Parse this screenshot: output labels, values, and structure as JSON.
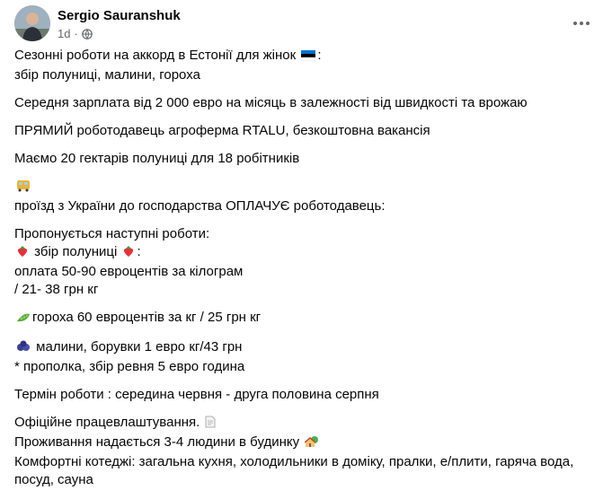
{
  "post": {
    "author": "Sergio Sauranshuk",
    "timestamp": "1d",
    "separator": "·",
    "privacy_icon": "globe-icon",
    "more_icon": "more-options-icon",
    "lines": {
      "l1": "Сезонні роботи на аккорд  в Естонії для жінок",
      "l2": "збір полуниці, малини,  гороха",
      "l3": "Середня зарплата від 2 000 евро на місяць в залежності від швидкості та врожаю",
      "l4": "ПРЯМИЙ роботодавець агроферма RTALU, безкоштовна вакансія",
      "l5": "Маємо 20 гектарів полуниці для 18 робітників",
      "l6": "проїзд з України до господарства ОПЛАЧУЄ роботодавець:",
      "l7": "Пропонується наступні роботи:",
      "l8": "збір полуниці",
      "l9": "оплата 50-90 евроцентів за  кілограм",
      "l10": "/ 21- 38 грн кг",
      "l11": "гороха 60 евроцентів за кг / 25 грн кг",
      "l12": "малини, борувки 1 евро кг/43 грн",
      "l13": "* прополка, збір ревня 5 евро година",
      "l14": "Термін роботи : середина червня - друга половина серпня",
      "l15": "Офіційне  працевлаштування.",
      "l16": "Проживання надається 3-4 людини в будинку",
      "l17": "Комфортні котеджі: загальна кухня, холодильники в домiку,  пралки, е/плити, гаряча вода,",
      "l18": "посуд, сауна"
    },
    "emojis": {
      "flag": "estonia-flag-icon",
      "bus": "bus-icon",
      "strawberry": "strawberry-icon",
      "pea": "pea-pod-icon",
      "blueberries": "blueberries-icon",
      "document": "document-icon",
      "house": "house-with-garden-icon"
    }
  }
}
